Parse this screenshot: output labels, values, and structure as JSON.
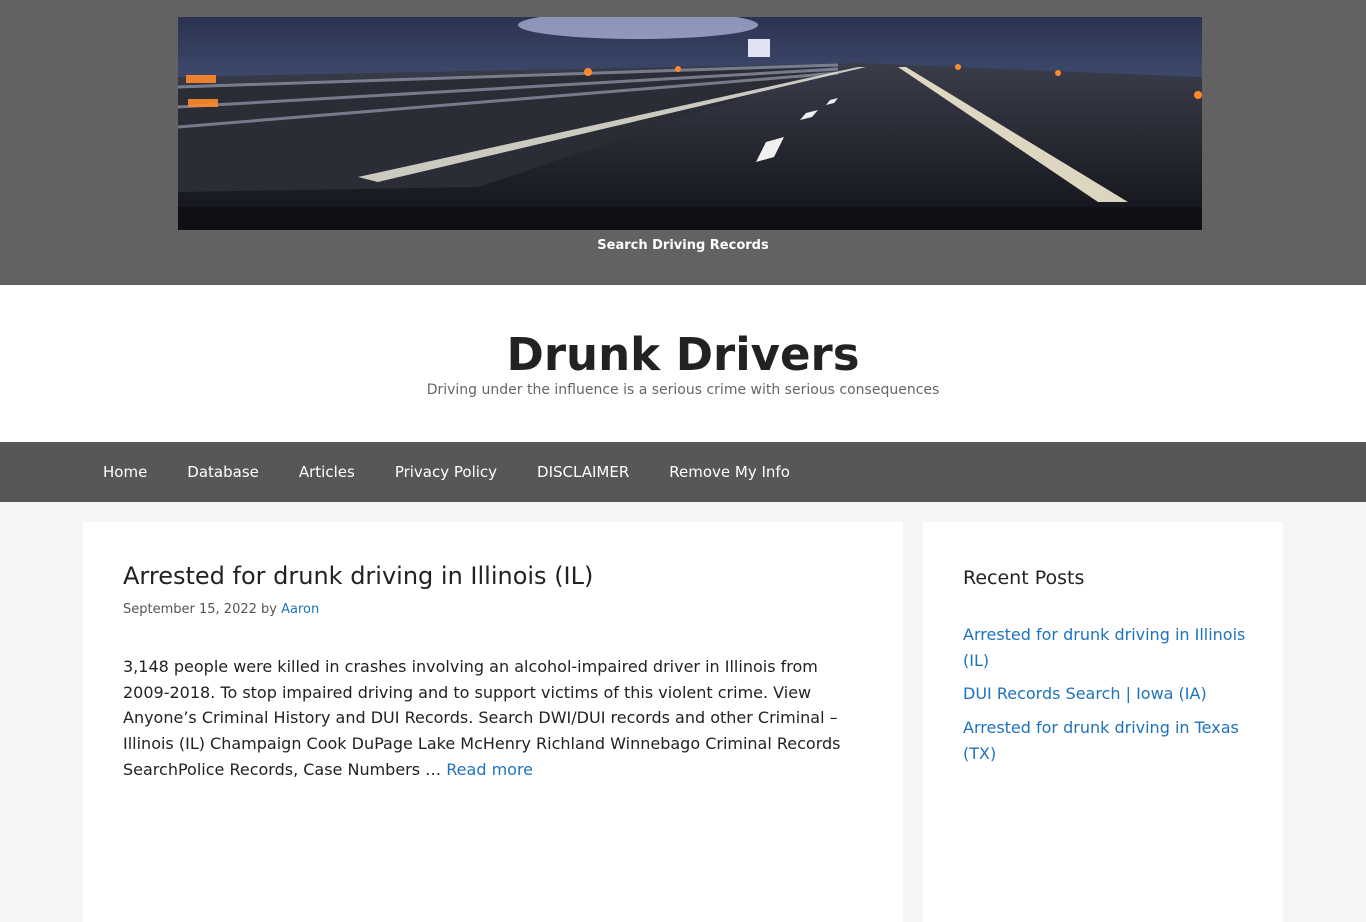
{
  "banner": {
    "caption": "Search Driving Records"
  },
  "site": {
    "title": "Drunk Drivers",
    "tagline": "Driving under the influence is a serious crime with serious consequences"
  },
  "nav": {
    "items": [
      "Home",
      "Database",
      "Articles",
      "Privacy Policy",
      "DISCLAIMER",
      "Remove My Info"
    ]
  },
  "post": {
    "title": "Arrested for drunk driving in Illinois (IL)",
    "date": "September 15, 2022",
    "by": "by",
    "author": "Aaron",
    "excerpt": "3,148 people were killed in crashes involving an alcohol-impaired driver in Illinois from 2009-2018. To stop impaired driving and to support victims of this violent crime. View Anyone’s Criminal History and DUI Records. Search DWI/DUI records and other Criminal – Illinois (IL) Champaign Cook DuPage Lake McHenry Richland Winnebago Criminal Records SearchPolice Records, Case Numbers …",
    "read_more": "Read more"
  },
  "sidebar": {
    "widget_title": "Recent Posts",
    "recent_posts": [
      "Arrested for drunk driving in Illinois (IL)",
      "DUI Records Search | Iowa (IA)",
      "Arrested for drunk driving in Texas (TX)"
    ]
  },
  "colors": {
    "banner_bg": "#626262",
    "nav_bg": "#575757",
    "link": "#1e73be",
    "page_bg": "#f4f5f7"
  }
}
